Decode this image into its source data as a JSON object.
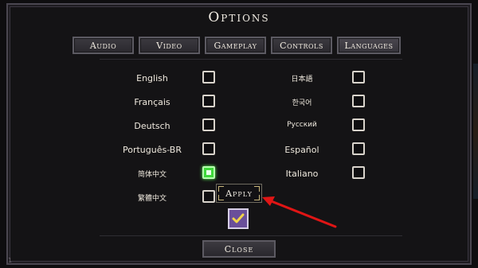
{
  "title": "Options",
  "tabs": [
    {
      "label": "Audio"
    },
    {
      "label": "Video"
    },
    {
      "label": "Gameplay"
    },
    {
      "label": "Controls"
    },
    {
      "label": "Languages"
    }
  ],
  "languages": {
    "left": [
      {
        "label": "English",
        "checked": false
      },
      {
        "label": "Français",
        "checked": false
      },
      {
        "label": "Deutsch",
        "checked": false
      },
      {
        "label": "Português-BR",
        "checked": false
      },
      {
        "label": "简体中文",
        "checked": true
      },
      {
        "label": "繁體中文",
        "checked": false
      }
    ],
    "right": [
      {
        "label": "日本語",
        "checked": false
      },
      {
        "label": "한국어",
        "checked": false
      },
      {
        "label": "Русский",
        "checked": false
      },
      {
        "label": "Español",
        "checked": false
      },
      {
        "label": "Italiano",
        "checked": false
      }
    ]
  },
  "apply_label": "Apply",
  "close_label": "Close",
  "edge_number": "1",
  "colors": {
    "checked_green": "#3fd83a",
    "apply_check_purple": "#6a4f9a",
    "arrow_red": "#e01515"
  }
}
